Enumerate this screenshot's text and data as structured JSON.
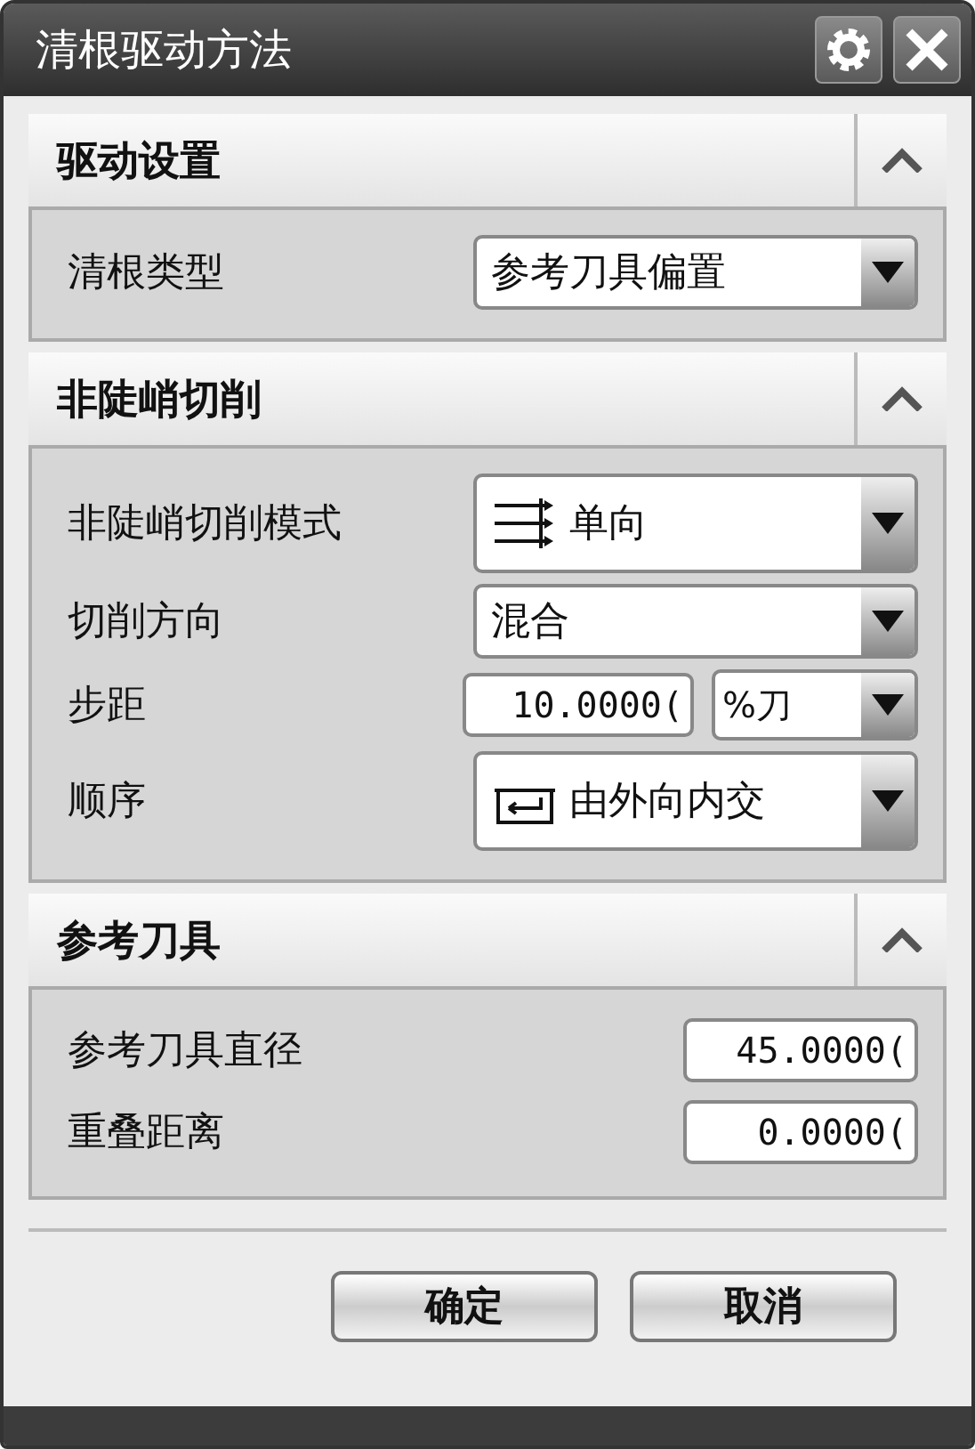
{
  "window": {
    "title": "清根驱动方法"
  },
  "sections": [
    {
      "title": "驱动设置",
      "expanded": true,
      "rows": [
        {
          "kind": "dropdown",
          "label": "清根类型",
          "value": "参考刀具偏置"
        }
      ]
    },
    {
      "title": "非陡峭切削",
      "expanded": true,
      "rows": [
        {
          "kind": "dropdown",
          "label": "非陡峭切削模式",
          "value": "单向"
        },
        {
          "kind": "dropdown",
          "label": "切削方向",
          "value": "混合"
        },
        {
          "kind": "number_unit",
          "label": "步距",
          "value": "10.0000(",
          "unit": "%刀"
        },
        {
          "kind": "dropdown",
          "label": "顺序",
          "value": "由外向内交"
        }
      ]
    },
    {
      "title": "参考刀具",
      "expanded": true,
      "rows": [
        {
          "kind": "number",
          "label": "参考刀具直径",
          "value": "45.0000("
        },
        {
          "kind": "number",
          "label": "重叠距离",
          "value": "0.0000("
        }
      ]
    }
  ],
  "buttons": [
    "确定",
    "取消"
  ]
}
